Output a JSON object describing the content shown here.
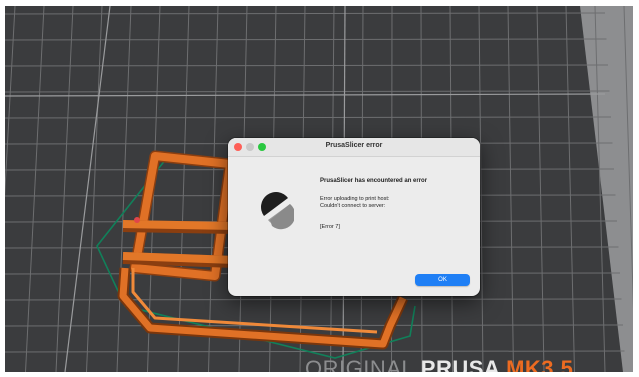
{
  "dialog": {
    "title": "PrusaSlicer error",
    "heading": "PrusaSlicer has encountered an error",
    "message_line1": "Error uploading to print host:",
    "message_line2": "Couldn't connect to server:",
    "error_code": "[Error 7]",
    "ok_label": "OK",
    "icon": "prusaslicer-logo-icon"
  },
  "bed": {
    "brand_word1": "ORIGINAL",
    "brand_word2": "PRUSA",
    "brand_word3": "MK3.5"
  },
  "colors": {
    "bed": "#3a3b3d",
    "grid": "#6f7072",
    "model": "#d86a1e",
    "travel": "#0f7a4f",
    "accent_button": "#1f7ff5",
    "brand_accent": "#ed6b21"
  }
}
